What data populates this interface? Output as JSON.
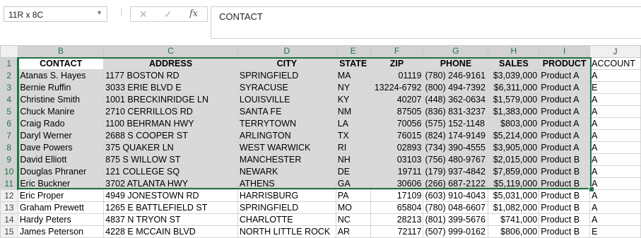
{
  "namebox": {
    "value": "11R x 8C"
  },
  "formula": {
    "value": "CONTACT"
  },
  "icons": {
    "cancel": "close-icon",
    "enter": "check-icon",
    "function": "fx-icon"
  },
  "columns": [
    "B",
    "C",
    "D",
    "E",
    "F",
    "G",
    "H",
    "I",
    "J"
  ],
  "rows": [
    {
      "num": "1",
      "cells": [
        "CONTACT",
        "ADDRESS",
        "CITY",
        "STATE",
        "ZIP",
        "PHONE",
        "SALES",
        "PRODUCT",
        "ACCOUNT"
      ]
    },
    {
      "num": "2",
      "cells": [
        "Atanas S. Hayes",
        "1177 BOSTON RD",
        "SPRINGFIELD",
        "MA",
        "01119",
        "(780) 246-9161",
        "$3,039,000",
        "Product A",
        "A"
      ]
    },
    {
      "num": "3",
      "cells": [
        "Bernie Ruffin",
        "3033 ERIE BLVD E",
        "SYRACUSE",
        "NY",
        "13224-6792",
        "(800) 494-7392",
        "$6,311,000",
        "Product A",
        "E"
      ]
    },
    {
      "num": "4",
      "cells": [
        "Christine Smith",
        "1001 BRECKINRIDGE LN",
        "LOUISVILLE",
        "KY",
        "40207",
        "(448) 362-0634",
        "$1,579,000",
        "Product A",
        "A"
      ]
    },
    {
      "num": "5",
      "cells": [
        "Chuck Manire",
        "2710 CERRILLOS RD",
        "SANTA FE",
        "NM",
        "87505",
        "(836) 831-3237",
        "$1,383,000",
        "Product A",
        "A"
      ]
    },
    {
      "num": "6",
      "cells": [
        "Craig Rado",
        "1100 BEHRMAN HWY",
        "TERRYTOWN",
        "LA",
        "70056",
        "(575) 152-1148",
        "$803,000",
        "Product A",
        "A"
      ]
    },
    {
      "num": "7",
      "cells": [
        "Daryl Werner",
        "2688 S COOPER ST",
        "ARLINGTON",
        "TX",
        "76015",
        "(824) 174-9149",
        "$5,214,000",
        "Product A",
        "A"
      ]
    },
    {
      "num": "8",
      "cells": [
        "Dave Powers",
        "375 QUAKER LN",
        "WEST WARWICK",
        "RI",
        "02893",
        "(734) 390-4555",
        "$3,905,000",
        "Product A",
        "A"
      ]
    },
    {
      "num": "9",
      "cells": [
        "David Elliott",
        "875 S WILLOW ST",
        "MANCHESTER",
        "NH",
        "03103",
        "(756) 480-9767",
        "$2,015,000",
        "Product B",
        "A"
      ]
    },
    {
      "num": "10",
      "cells": [
        "Douglas Phraner",
        "121 COLLEGE SQ",
        "NEWARK",
        "DE",
        "19711",
        "(179) 937-4842",
        "$7,859,000",
        "Product B",
        "A"
      ]
    },
    {
      "num": "11",
      "cells": [
        "Eric Buckner",
        "3702 ATLANTA HWY",
        "ATHENS",
        "GA",
        "30606",
        "(266) 687-2122",
        "$5,119,000",
        "Product B",
        "A"
      ]
    },
    {
      "num": "12",
      "cells": [
        "Eric Proper",
        "4949 JONESTOWN RD",
        "HARRISBURG",
        "PA",
        "17109",
        "(603) 910-4043",
        "$5,031,000",
        "Product B",
        "A"
      ]
    },
    {
      "num": "13",
      "cells": [
        "Graham Prewett",
        "1265 E BATTLEFIELD ST",
        "SPRINGFIELD",
        "MO",
        "65804",
        "(780) 048-6607",
        "$1,082,000",
        "Product B",
        "A"
      ]
    },
    {
      "num": "14",
      "cells": [
        "Hardy Peters",
        "4837 N TRYON ST",
        "CHARLOTTE",
        "NC",
        "28213",
        "(801) 399-5676",
        "$741,000",
        "Product B",
        "A"
      ]
    },
    {
      "num": "15",
      "cells": [
        "James Peterson",
        "4228 E MCCAIN BLVD",
        "NORTH LITTLE ROCK",
        "AR",
        "72117",
        "(507) 999-0162",
        "$806,000",
        "Product B",
        "E"
      ]
    }
  ]
}
